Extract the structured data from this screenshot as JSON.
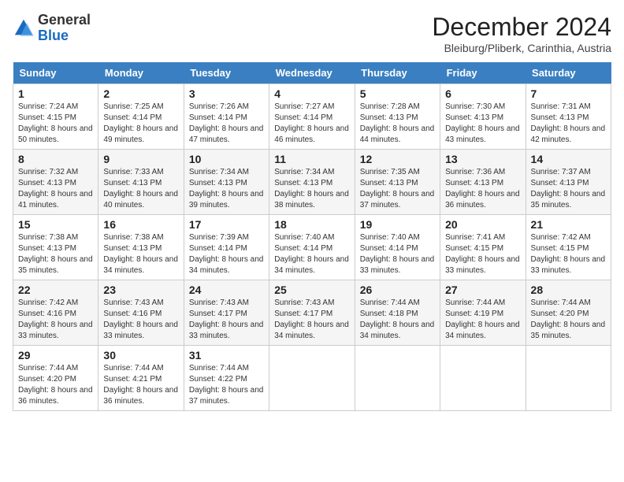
{
  "header": {
    "logo_general": "General",
    "logo_blue": "Blue",
    "title": "December 2024",
    "subtitle": "Bleiburg/Pliberk, Carinthia, Austria"
  },
  "weekdays": [
    "Sunday",
    "Monday",
    "Tuesday",
    "Wednesday",
    "Thursday",
    "Friday",
    "Saturday"
  ],
  "weeks": [
    [
      {
        "day": "1",
        "sunrise": "7:24 AM",
        "sunset": "4:15 PM",
        "daylight": "8 hours and 50 minutes."
      },
      {
        "day": "2",
        "sunrise": "7:25 AM",
        "sunset": "4:14 PM",
        "daylight": "8 hours and 49 minutes."
      },
      {
        "day": "3",
        "sunrise": "7:26 AM",
        "sunset": "4:14 PM",
        "daylight": "8 hours and 47 minutes."
      },
      {
        "day": "4",
        "sunrise": "7:27 AM",
        "sunset": "4:14 PM",
        "daylight": "8 hours and 46 minutes."
      },
      {
        "day": "5",
        "sunrise": "7:28 AM",
        "sunset": "4:13 PM",
        "daylight": "8 hours and 44 minutes."
      },
      {
        "day": "6",
        "sunrise": "7:30 AM",
        "sunset": "4:13 PM",
        "daylight": "8 hours and 43 minutes."
      },
      {
        "day": "7",
        "sunrise": "7:31 AM",
        "sunset": "4:13 PM",
        "daylight": "8 hours and 42 minutes."
      }
    ],
    [
      {
        "day": "8",
        "sunrise": "7:32 AM",
        "sunset": "4:13 PM",
        "daylight": "8 hours and 41 minutes."
      },
      {
        "day": "9",
        "sunrise": "7:33 AM",
        "sunset": "4:13 PM",
        "daylight": "8 hours and 40 minutes."
      },
      {
        "day": "10",
        "sunrise": "7:34 AM",
        "sunset": "4:13 PM",
        "daylight": "8 hours and 39 minutes."
      },
      {
        "day": "11",
        "sunrise": "7:34 AM",
        "sunset": "4:13 PM",
        "daylight": "8 hours and 38 minutes."
      },
      {
        "day": "12",
        "sunrise": "7:35 AM",
        "sunset": "4:13 PM",
        "daylight": "8 hours and 37 minutes."
      },
      {
        "day": "13",
        "sunrise": "7:36 AM",
        "sunset": "4:13 PM",
        "daylight": "8 hours and 36 minutes."
      },
      {
        "day": "14",
        "sunrise": "7:37 AM",
        "sunset": "4:13 PM",
        "daylight": "8 hours and 35 minutes."
      }
    ],
    [
      {
        "day": "15",
        "sunrise": "7:38 AM",
        "sunset": "4:13 PM",
        "daylight": "8 hours and 35 minutes."
      },
      {
        "day": "16",
        "sunrise": "7:38 AM",
        "sunset": "4:13 PM",
        "daylight": "8 hours and 34 minutes."
      },
      {
        "day": "17",
        "sunrise": "7:39 AM",
        "sunset": "4:14 PM",
        "daylight": "8 hours and 34 minutes."
      },
      {
        "day": "18",
        "sunrise": "7:40 AM",
        "sunset": "4:14 PM",
        "daylight": "8 hours and 34 minutes."
      },
      {
        "day": "19",
        "sunrise": "7:40 AM",
        "sunset": "4:14 PM",
        "daylight": "8 hours and 33 minutes."
      },
      {
        "day": "20",
        "sunrise": "7:41 AM",
        "sunset": "4:15 PM",
        "daylight": "8 hours and 33 minutes."
      },
      {
        "day": "21",
        "sunrise": "7:42 AM",
        "sunset": "4:15 PM",
        "daylight": "8 hours and 33 minutes."
      }
    ],
    [
      {
        "day": "22",
        "sunrise": "7:42 AM",
        "sunset": "4:16 PM",
        "daylight": "8 hours and 33 minutes."
      },
      {
        "day": "23",
        "sunrise": "7:43 AM",
        "sunset": "4:16 PM",
        "daylight": "8 hours and 33 minutes."
      },
      {
        "day": "24",
        "sunrise": "7:43 AM",
        "sunset": "4:17 PM",
        "daylight": "8 hours and 33 minutes."
      },
      {
        "day": "25",
        "sunrise": "7:43 AM",
        "sunset": "4:17 PM",
        "daylight": "8 hours and 34 minutes."
      },
      {
        "day": "26",
        "sunrise": "7:44 AM",
        "sunset": "4:18 PM",
        "daylight": "8 hours and 34 minutes."
      },
      {
        "day": "27",
        "sunrise": "7:44 AM",
        "sunset": "4:19 PM",
        "daylight": "8 hours and 34 minutes."
      },
      {
        "day": "28",
        "sunrise": "7:44 AM",
        "sunset": "4:20 PM",
        "daylight": "8 hours and 35 minutes."
      }
    ],
    [
      {
        "day": "29",
        "sunrise": "7:44 AM",
        "sunset": "4:20 PM",
        "daylight": "8 hours and 36 minutes."
      },
      {
        "day": "30",
        "sunrise": "7:44 AM",
        "sunset": "4:21 PM",
        "daylight": "8 hours and 36 minutes."
      },
      {
        "day": "31",
        "sunrise": "7:44 AM",
        "sunset": "4:22 PM",
        "daylight": "8 hours and 37 minutes."
      },
      null,
      null,
      null,
      null
    ]
  ]
}
